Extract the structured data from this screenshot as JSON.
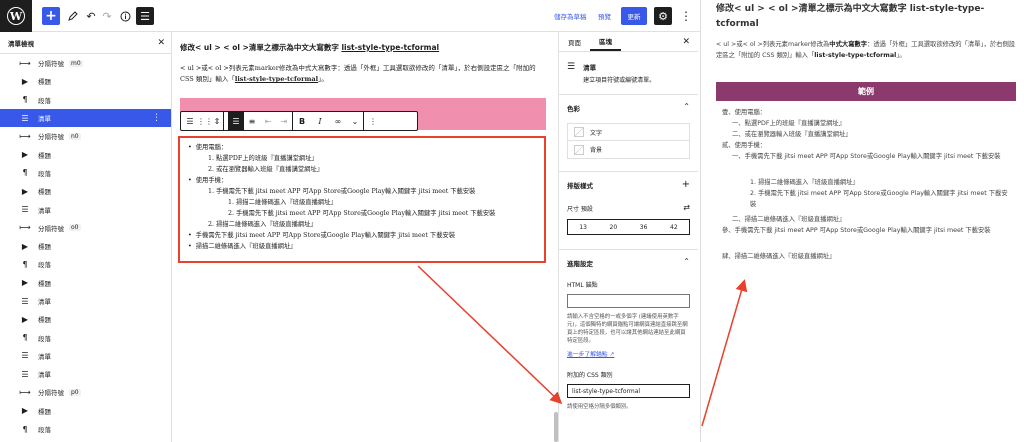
{
  "toolbar": {
    "logo_glyph": "W",
    "add_glyph": "+",
    "save_draft": "儲存為草稿",
    "preview": "預覽",
    "publish": "更新"
  },
  "listview": {
    "title": "清單檢視",
    "items": [
      {
        "icon": "⟼",
        "label": "分隔符號",
        "anchor": "m0"
      },
      {
        "icon": "▶",
        "label": "標題",
        "anchor": ""
      },
      {
        "icon": "¶",
        "label": "段落",
        "anchor": ""
      },
      {
        "icon": "☰",
        "label": "清單",
        "anchor": "",
        "active": true
      },
      {
        "icon": "⟼",
        "label": "分隔符號",
        "anchor": "n0"
      },
      {
        "icon": "▶",
        "label": "標題",
        "anchor": ""
      },
      {
        "icon": "¶",
        "label": "段落",
        "anchor": ""
      },
      {
        "icon": "▶",
        "label": "標題",
        "anchor": ""
      },
      {
        "icon": "☰",
        "label": "清單",
        "anchor": ""
      },
      {
        "icon": "⟼",
        "label": "分隔符號",
        "anchor": "o0"
      },
      {
        "icon": "▶",
        "label": "標題",
        "anchor": ""
      },
      {
        "icon": "¶",
        "label": "段落",
        "anchor": ""
      },
      {
        "icon": "▶",
        "label": "標題",
        "anchor": ""
      },
      {
        "icon": "☰",
        "label": "清單",
        "anchor": ""
      },
      {
        "icon": "▶",
        "label": "標題",
        "anchor": ""
      },
      {
        "icon": "¶",
        "label": "段落",
        "anchor": ""
      },
      {
        "icon": "☰",
        "label": "清單",
        "anchor": ""
      },
      {
        "icon": "☰",
        "label": "清單",
        "anchor": ""
      },
      {
        "icon": "⟼",
        "label": "分隔符號",
        "anchor": "p0"
      },
      {
        "icon": "▶",
        "label": "標題",
        "anchor": ""
      },
      {
        "icon": "¶",
        "label": "段落",
        "anchor": ""
      }
    ]
  },
  "canvas": {
    "title_a": "修改< ul > < ol >清單之標示為中文大寫數字 ",
    "title_b": "list-style-type-tcformal",
    "para_a": "< ul >或< ol >列表元素marker修改為中式大寫數字：透過「外框」工具選取欲修改的「清單」，於右側設定區之「附加的 CSS 類別」輸入「",
    "para_b": "list-style-type-tcformal",
    "para_c": "」。",
    "list": [
      "使用電腦：",
      "1. 點選PDF上的班級『直播講堂網址』",
      "2. 或在瀏覽器輸入班級『直播講堂網址』",
      "使用手機：",
      "1. 手機需先下載 jitsi meet APP 可App Store或Google Play輸入關鍵字 jitsi meet 下載安裝",
      "1. 掃描二維條碼進入『班級直播網址』",
      "2. 手機需先下載 jitsi meet APP 可App Store或Google Play輸入關鍵字 jitsi meet 下載安裝",
      "2. 掃描二維條碼進入『班級直播網址』",
      "手機需先下載 jitsi meet APP 可App Store或Google Play輸入關鍵字 jitsi meet 下載安裝",
      "掃描二維條碼進入『班級直播網址』"
    ]
  },
  "sidebar": {
    "tab_page": "頁面",
    "tab_block": "區塊",
    "block_title": "清單",
    "block_desc": "建立項目符號或編號清單。",
    "color_title": "色彩",
    "color_text": "文字",
    "color_bg": "背景",
    "typo_title": "排版樣式",
    "size_label": "尺寸 預設",
    "sizes": [
      "13",
      "20",
      "36",
      "42"
    ],
    "advanced_title": "進階設定",
    "html_anchor_label": "HTML 錨點",
    "html_anchor_help": "請輸入不含空格的一或多個字 (建議使用英數字元)，這個獨特的網頁錨點可讓網頁連結直接跳至網頁上的特定區段，也可以讓其他網站連結至此網頁特定區段。",
    "learn_more": "進一步了解錨點",
    "css_label": "附加的 CSS 類別",
    "css_value": "list-style-type-tcformal",
    "css_help": "請使用空格分隔多個類別。"
  },
  "preview": {
    "title": "修改< ul > < ol >清單之標示為中文大寫數字 list-style-type-tcformal",
    "desc_a": "< ul >或< ol >列表元素marker修改為",
    "desc_b": "中式大寫數字",
    "desc_c": "：透過「外框」工具選取欲修改的「清單」，於右側設定區之「附加的 CSS 類別」輸入「",
    "desc_d": "list-style-type-tcformal",
    "desc_e": "」。",
    "banner": "範例",
    "list": [
      "壹、使用電腦：",
      "一、點選PDF上的班級『直播講堂網址』",
      "二、或在瀏覽器輸入班級『直播講堂網址』",
      "貳、使用手機：",
      "一、手機需先下載 jitsi meet APP 可App Store或Google Play輸入關鍵字 jitsi meet 下載安裝",
      "1. 掃描二維條碼進入『班級直播網址』",
      "2. 手機需先下載 jitsi meet APP 可App Store或Google Play輸入關鍵字 jitsi meet 下載安裝",
      "二、掃描二維條碼進入『班級直播網址』",
      "參、手機需先下載 jitsi meet APP 可App Store或Google Play輸入關鍵字 jitsi meet 下載安裝",
      "肆、掃描二維條碼進入『班級直播網址』"
    ]
  },
  "colors": {
    "accent": "#3858e9",
    "highlight_border": "#e8412c",
    "banner": "#8c3a6e",
    "pink": "#f08fae"
  }
}
